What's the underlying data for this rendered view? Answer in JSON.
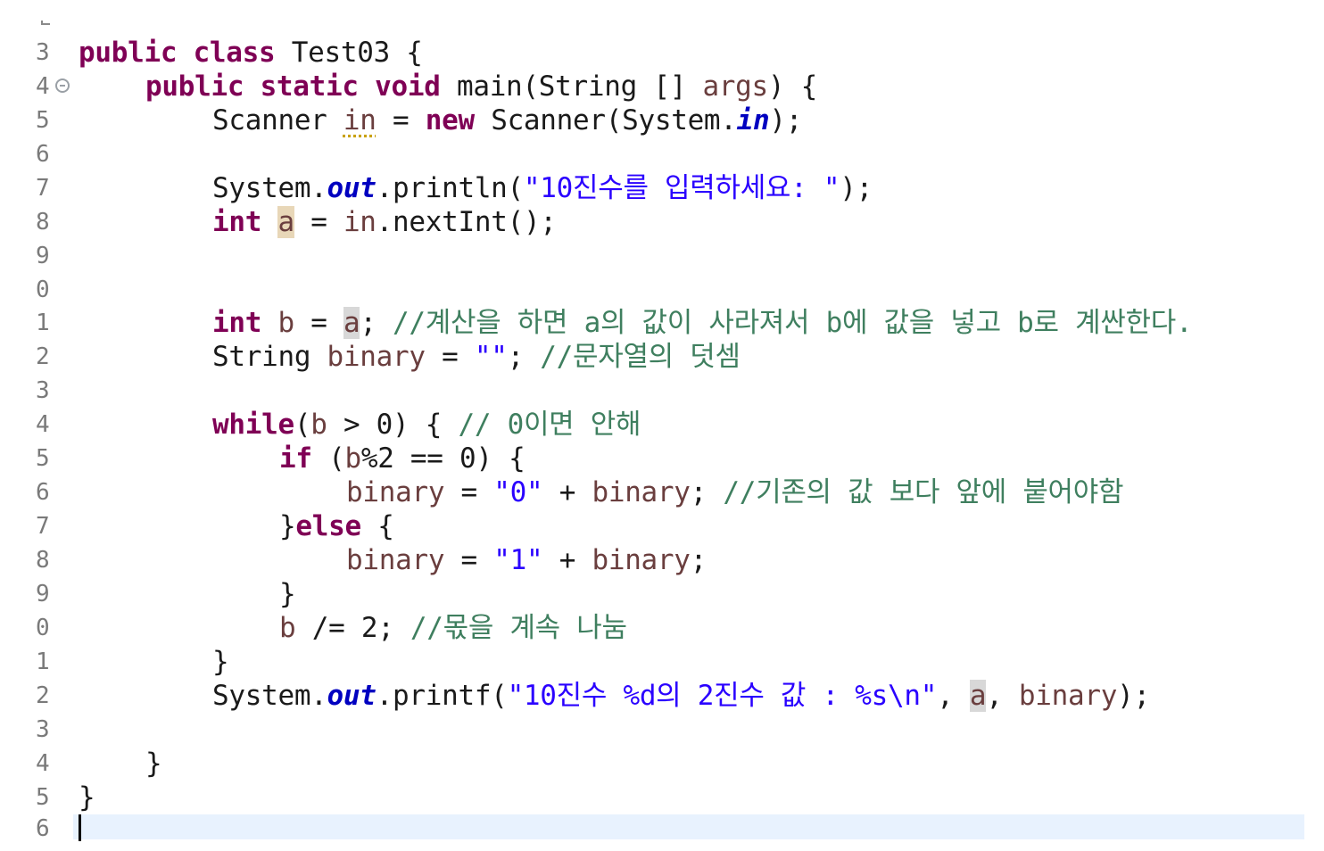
{
  "editor": {
    "line_numbers": [
      "3",
      "4",
      "5",
      "6",
      "7",
      "8",
      "9",
      "0",
      "1",
      "2",
      "3",
      "4",
      "5",
      "6",
      "7",
      "8",
      "9",
      "0",
      "1",
      "2",
      "3",
      "4",
      "5",
      "6"
    ],
    "l1": {
      "kw1": "public",
      "kw2": "class",
      "name": "Test03 {"
    },
    "l2": {
      "kw1": "public",
      "kw2": "static",
      "kw3": "void",
      "t1": "main(String [] ",
      "args": "args",
      "t2": ") {"
    },
    "l3": {
      "t1": "Scanner ",
      "in": "in",
      "t2": " = ",
      "kw": "new",
      "t3": " Scanner(System.",
      "fld": "in",
      "t4": ");"
    },
    "l5": {
      "t1": "System.",
      "fld": "out",
      "t2": ".println(",
      "str": "\"10진수를 입력하세요: \"",
      "t3": ");"
    },
    "l6": {
      "kw": "int",
      "a": "a",
      "t1": " = ",
      "in": "in",
      "t2": ".nextInt();"
    },
    "l9": {
      "kw": "int",
      "b": "b",
      "t1": " = ",
      "a": "a",
      "t2": "; ",
      "com": "//계산을 하면 a의 값이 사라져서 b에 값을 넣고 b로 계싼한다."
    },
    "l10": {
      "t1": "String ",
      "binary": "binary",
      "t2": " = ",
      "str": "\"\"",
      "t3": "; ",
      "com": "//문자열의 덧셈"
    },
    "l12": {
      "kw": "while",
      "t1": "(",
      "b": "b",
      "t2": " > 0) { ",
      "com": "// 0이면 안해"
    },
    "l13": {
      "kw": "if",
      "t1": " (",
      "b": "b",
      "t2": "%2 == 0) {"
    },
    "l14": {
      "binary1": "binary",
      "t1": " = ",
      "str": "\"0\"",
      "t2": " + ",
      "binary2": "binary",
      "t3": "; ",
      "com": "//기존의 값 보다 앞에 붙어야함"
    },
    "l15": {
      "t1": "}",
      "kw": "else",
      "t2": " {"
    },
    "l16": {
      "binary1": "binary",
      "t1": " = ",
      "str": "\"1\"",
      "t2": " + ",
      "binary2": "binary",
      "t3": ";"
    },
    "l17": {
      "t1": "}"
    },
    "l18": {
      "b": "b",
      "t1": " /= 2; ",
      "com": "//몫을 계속 나눔"
    },
    "l19": {
      "t1": "}"
    },
    "l20": {
      "t1": "System.",
      "fld": "out",
      "t2": ".printf(",
      "str": "\"10진수 %d의 2진수 값 : %s\\n\"",
      "t3": ", ",
      "a": "a",
      "t4": ", ",
      "binary": "binary",
      "t5": ");"
    },
    "l22": {
      "t1": "}"
    },
    "l23": {
      "t1": "}"
    }
  }
}
